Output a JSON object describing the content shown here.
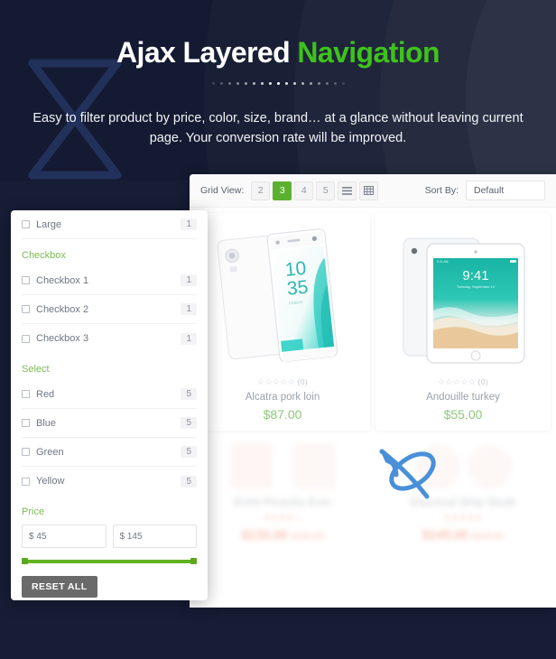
{
  "hero": {
    "title_main": "Ajax Layered ",
    "title_accent": "Navigation",
    "subtitle": "Easy to filter product by price, color, size, brand… at a glance without leaving current page. Your conversion rate will be improved.",
    "accent_color": "#3ec21c",
    "background_color": "#141a31",
    "dot_count": 17,
    "logo_icon": "hourglass-icon"
  },
  "toolbar": {
    "grid_view_label": "Grid View:",
    "grid_options": [
      "2",
      "3",
      "4",
      "5"
    ],
    "active_grid_option": "3",
    "list_icon": "list-view-icon",
    "table_icon": "table-view-icon",
    "sort_label": "Sort By:",
    "sort_value": "Default",
    "active_color": "#5cb030"
  },
  "filters": {
    "top_item": {
      "label": "Large",
      "count": "1"
    },
    "groups": [
      {
        "title": "Checkbox",
        "items": [
          {
            "label": "Checkbox 1",
            "count": "1"
          },
          {
            "label": "Checkbox 2",
            "count": "1"
          },
          {
            "label": "Checkbox 3",
            "count": "1"
          }
        ]
      },
      {
        "title": "Select",
        "items": [
          {
            "label": "Red",
            "count": "5"
          },
          {
            "label": "Blue",
            "count": "5"
          },
          {
            "label": "Green",
            "count": "5"
          },
          {
            "label": "Yellow",
            "count": "5"
          }
        ]
      }
    ],
    "price": {
      "title": "Price",
      "min_value": "$ 45",
      "max_value": "$ 145",
      "slider_color": "#62b321"
    },
    "reset_label": "RESET ALL",
    "heading_color": "#7dbb54"
  },
  "products": {
    "row1": [
      {
        "name": "Alcatra pork loin",
        "price": "$87.00",
        "rating_stars": "☆☆☆☆☆",
        "rating_count": "(0)",
        "image": "smartphone-image",
        "screen_time": "10\n35"
      },
      {
        "name": "Andouille turkey",
        "price": "$55.00",
        "rating_stars": "☆☆☆☆☆",
        "rating_count": "(0)",
        "image": "tablet-image",
        "screen_time": "9:41"
      }
    ],
    "row2": [
      {
        "name": "Enim Picanha Evin",
        "price": "$132.00",
        "old_price": "$150.00",
        "rating_stars": "★★★★☆",
        "image": "blurred-product-image"
      },
      {
        "name": "Eiusmod Strip Steak",
        "price": "$145.00",
        "old_price": "$166.00",
        "rating_stars": "★★★★★",
        "image": "blurred-product-image"
      }
    ]
  },
  "overlay": {
    "logo_icon": "orbit-logo-icon",
    "color": "#4a90d9"
  }
}
